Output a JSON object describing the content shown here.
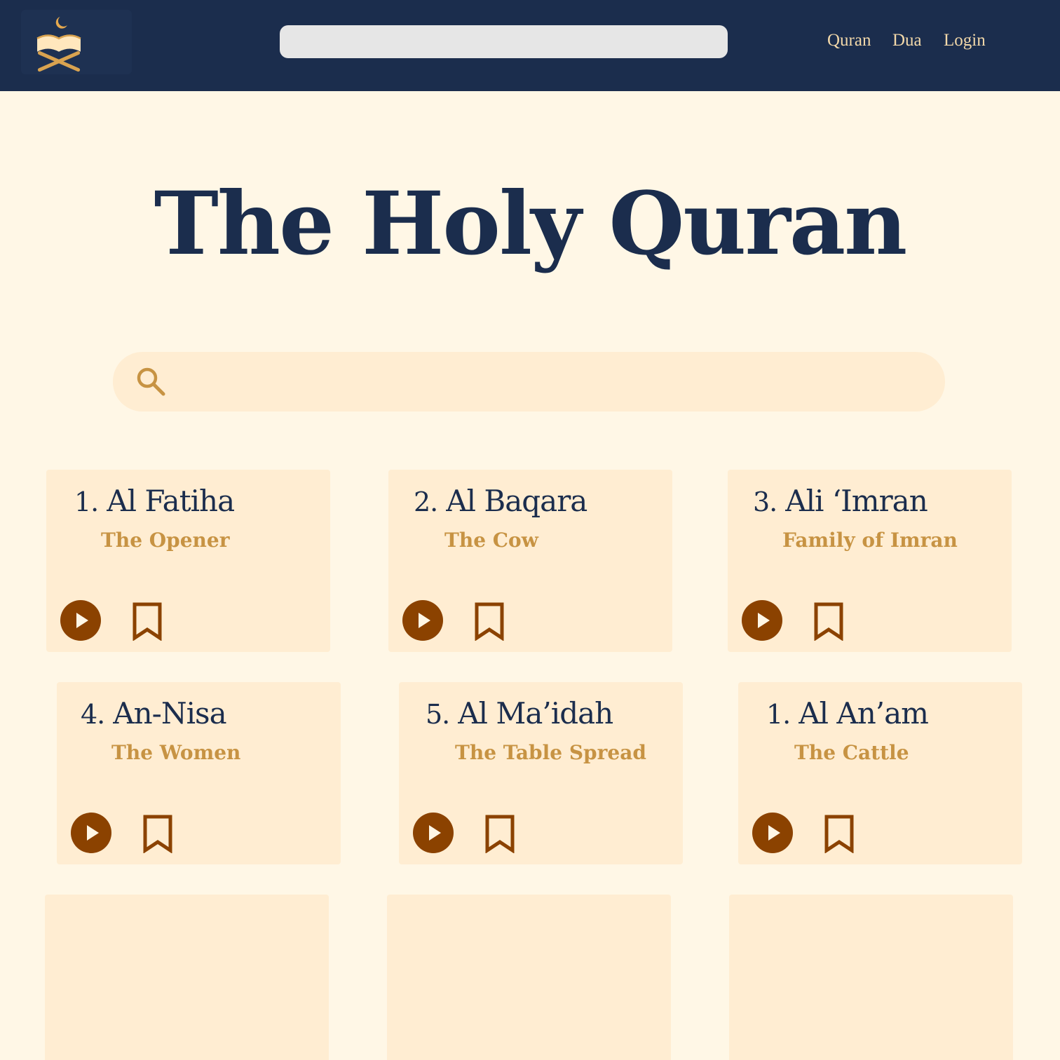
{
  "header": {
    "logo_icon": "quran-book-crescent-icon",
    "nav": [
      {
        "label": "Quran"
      },
      {
        "label": "Dua"
      },
      {
        "label": "Login"
      }
    ]
  },
  "hero": {
    "title": "The Holy Quran"
  },
  "search": {
    "icon": "search-icon",
    "placeholder": ""
  },
  "surahs": [
    {
      "number": "1.",
      "name": "Al Fatiha",
      "translation": "The Opener"
    },
    {
      "number": "2.",
      "name": "Al Baqara",
      "translation": "The  Cow"
    },
    {
      "number": "3.",
      "name": "Ali ‘Imran",
      "translation": "Family of Imran"
    },
    {
      "number": "4.",
      "name": "An-Nisa",
      "translation": "The  Women"
    },
    {
      "number": "5.",
      "name": "Al Ma’idah",
      "translation": "The  Table Spread"
    },
    {
      "number": "1.",
      "name": "Al An’am",
      "translation": "The Cattle"
    }
  ],
  "colors": {
    "header_bg": "#1B2D4D",
    "page_bg": "#FFF7E6",
    "card_bg": "#FFEDD2",
    "title_text": "#1B2D4D",
    "accent_gold": "#C79343",
    "action_brown": "#8B4200"
  }
}
